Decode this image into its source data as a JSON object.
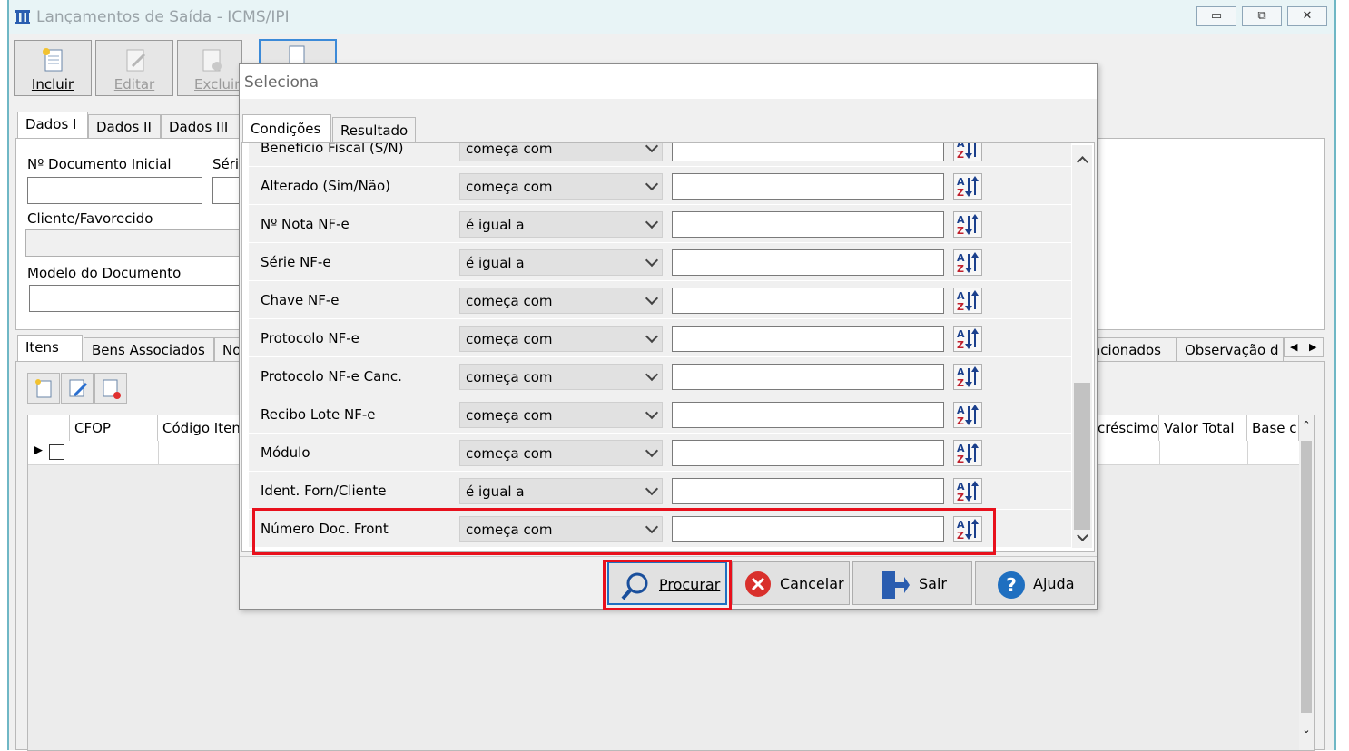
{
  "window": {
    "title": "Lançamentos de Saída - ICMS/IPI",
    "minimize": "▭",
    "maximize": "⧉",
    "close": "✕"
  },
  "toolbar": {
    "incluir": "Incluir",
    "editar": "Editar",
    "excluir": "Excluir"
  },
  "tabs_top": [
    "Dados I",
    "Dados II",
    "Dados III"
  ],
  "form": {
    "doc_inicial_label": "Nº Documento Inicial",
    "serie_label": "Séri",
    "cliente_label": "Cliente/Favorecido",
    "modelo_label": "Modelo do Documento"
  },
  "tabs_bottom": [
    "Itens",
    "Bens Associados",
    "No",
    "acionados",
    "Observação d"
  ],
  "grid": {
    "columns_left": [
      "CFOP",
      "Código Iten"
    ],
    "columns_right": [
      "créscimo",
      "Valor Total",
      "Base c"
    ]
  },
  "dialog": {
    "title": "Seleciona",
    "tabs": [
      "Condições",
      "Resultado"
    ],
    "rows": [
      {
        "field": "Benefício Fiscal (S/N)",
        "op": "começa com"
      },
      {
        "field": "Alterado (Sim/Não)",
        "op": "começa com"
      },
      {
        "field": "Nº Nota NF-e",
        "op": "é igual a"
      },
      {
        "field": "Série NF-e",
        "op": "é igual a"
      },
      {
        "field": "Chave NF-e",
        "op": "começa com"
      },
      {
        "field": "Protocolo NF-e",
        "op": "começa com"
      },
      {
        "field": "Protocolo NF-e Canc.",
        "op": "começa com"
      },
      {
        "field": "Recibo Lote NF-e",
        "op": "começa com"
      },
      {
        "field": "Módulo",
        "op": "começa com"
      },
      {
        "field": "Ident. Forn/Cliente",
        "op": "é igual a"
      },
      {
        "field": "Número Doc. Front",
        "op": "começa com"
      }
    ],
    "buttons": {
      "procurar": "Procurar",
      "cancelar": "Cancelar",
      "sair": "Sair",
      "ajuda": "Ajuda"
    }
  },
  "colors": {
    "highlight": "#e8101c",
    "accent": "#1f6fc0"
  }
}
